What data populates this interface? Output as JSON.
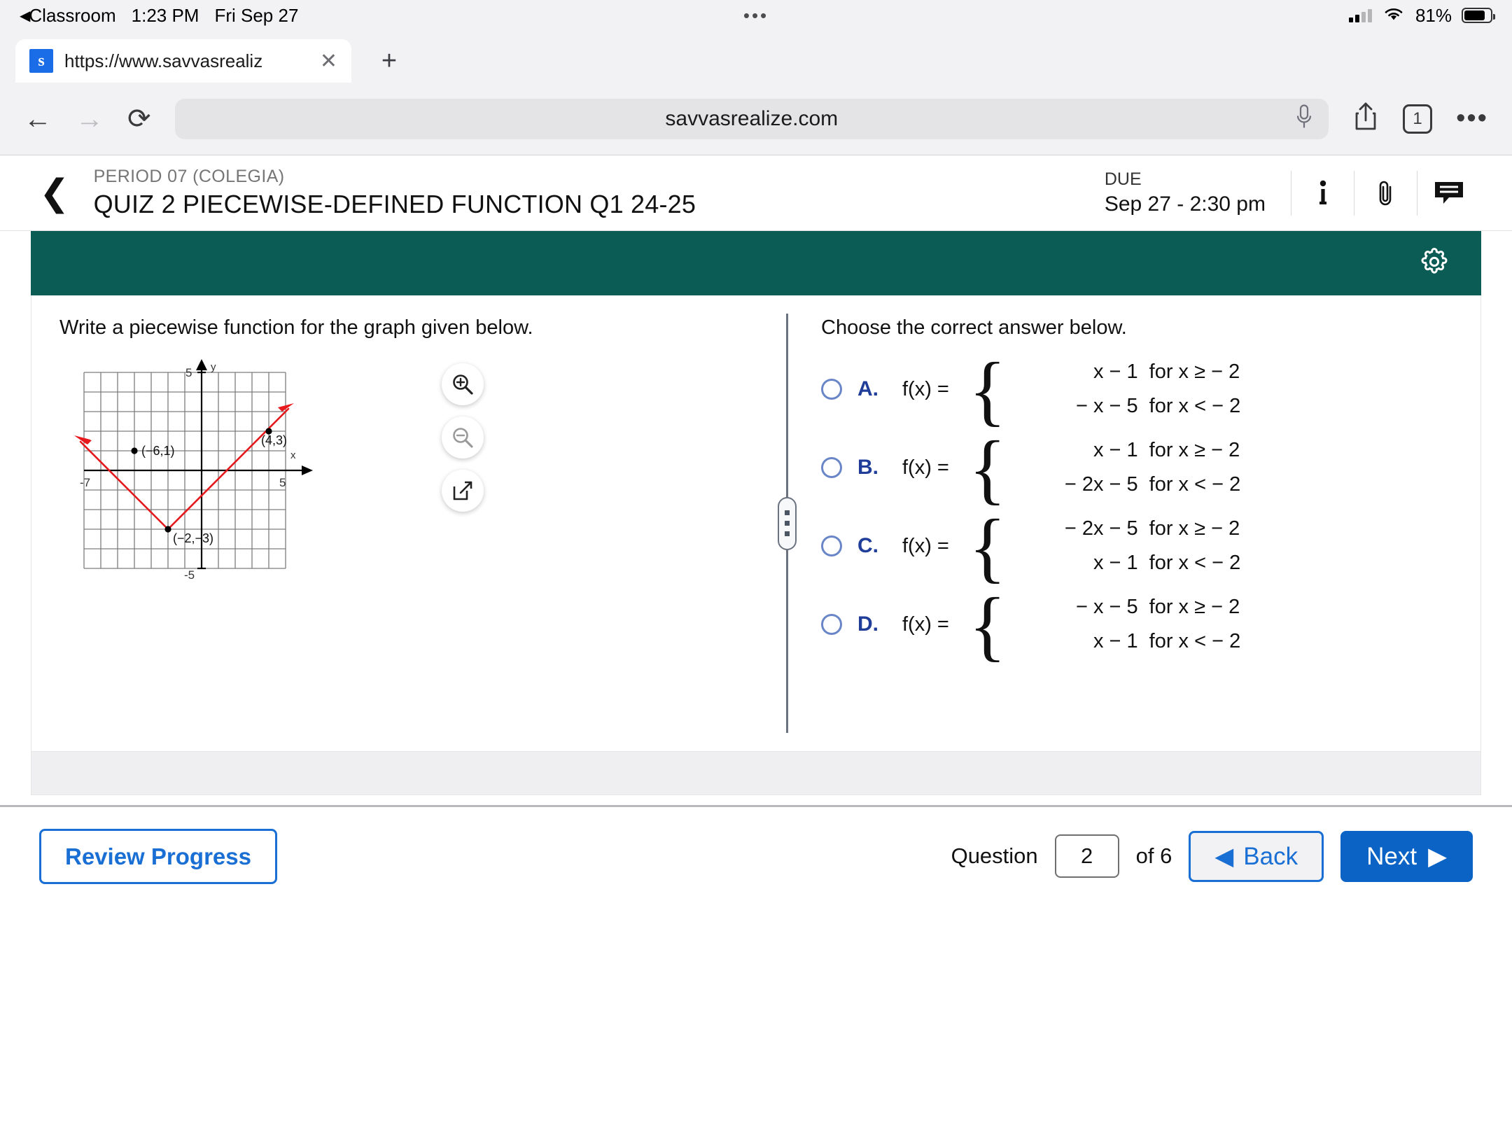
{
  "status_bar": {
    "back_app": "Classroom",
    "time": "1:23 PM",
    "date": "Fri Sep 27",
    "battery_percent": "81%"
  },
  "browser": {
    "tab_title": "https://www.savvasrealiz",
    "favicon_letter": "s",
    "close_glyph": "✕",
    "newtab_glyph": "+",
    "back_glyph": "←",
    "forward_glyph": "→",
    "reload_glyph": "⟳",
    "url": "savvasrealize.com",
    "tab_count": "1",
    "more_glyph": "•••"
  },
  "assignment": {
    "back_glyph": "❮",
    "period": "PERIOD 07 (COLEGIA)",
    "title": "QUIZ 2 PIECEWISE-DEFINED FUNCTION Q1 24-25",
    "due_label": "DUE",
    "due_value": "Sep 27 - 2:30 pm",
    "info_glyph": "i",
    "teal_color": "#0a5c55",
    "accent_blue": "#1a6fd4"
  },
  "exercise": {
    "prompt_left": "Write a piecewise function for the graph given below.",
    "prompt_right": "Choose the correct answer below."
  },
  "chart_data": {
    "type": "line",
    "title": "",
    "xlabel": "x",
    "ylabel": "y",
    "xlim": [
      -7,
      5
    ],
    "ylim": [
      -5,
      5
    ],
    "grid": true,
    "x_tick_labels": [
      "-7",
      "5"
    ],
    "y_tick_labels": [
      "5",
      "-5"
    ],
    "series": [
      {
        "name": "left-branch",
        "comment": "decreasing ray from upper-left to vertex",
        "points": [
          [
            -7,
            2
          ],
          [
            -2,
            -3
          ]
        ],
        "color": "#e8191c",
        "arrow_start": true
      },
      {
        "name": "right-branch",
        "comment": "increasing ray from vertex to upper-right",
        "points": [
          [
            -2,
            -3
          ],
          [
            5,
            4
          ]
        ],
        "color": "#e8191c",
        "arrow_end": true
      }
    ],
    "annotations": [
      {
        "label": "(-6,1)",
        "x": -6,
        "y": 1
      },
      {
        "label": "(4,3)",
        "x": 4,
        "y": 3
      },
      {
        "label": "(-2,-3)",
        "x": -2,
        "y": -3
      }
    ]
  },
  "tools": {
    "zoom_in": "zoom-in-icon",
    "zoom_out": "zoom-out-icon",
    "popout": "popout-icon"
  },
  "choices": [
    {
      "letter": "A.",
      "fx": "f(x) =",
      "cases": [
        {
          "expr": "x − 1",
          "cond": "for  x ≥ − 2"
        },
        {
          "expr": "− x − 5",
          "cond": "for  x < − 2"
        }
      ]
    },
    {
      "letter": "B.",
      "fx": "f(x) =",
      "cases": [
        {
          "expr": "x − 1",
          "cond": "for  x ≥ − 2"
        },
        {
          "expr": "− 2x − 5",
          "cond": "for  x < − 2"
        }
      ]
    },
    {
      "letter": "C.",
      "fx": "f(x) =",
      "cases": [
        {
          "expr": "− 2x − 5",
          "cond": "for  x ≥ − 2"
        },
        {
          "expr": "x − 1",
          "cond": "for  x < − 2"
        }
      ]
    },
    {
      "letter": "D.",
      "fx": "f(x) =",
      "cases": [
        {
          "expr": "− x − 5",
          "cond": "for  x ≥ − 2"
        },
        {
          "expr": "x − 1",
          "cond": "for  x < − 2"
        }
      ]
    }
  ],
  "footer": {
    "review_progress": "Review Progress",
    "question_label": "Question",
    "question_number": "2",
    "of_label": "of 6",
    "back_label": "Back",
    "back_arrow": "◀",
    "next_label": "Next",
    "next_arrow": "▶"
  }
}
